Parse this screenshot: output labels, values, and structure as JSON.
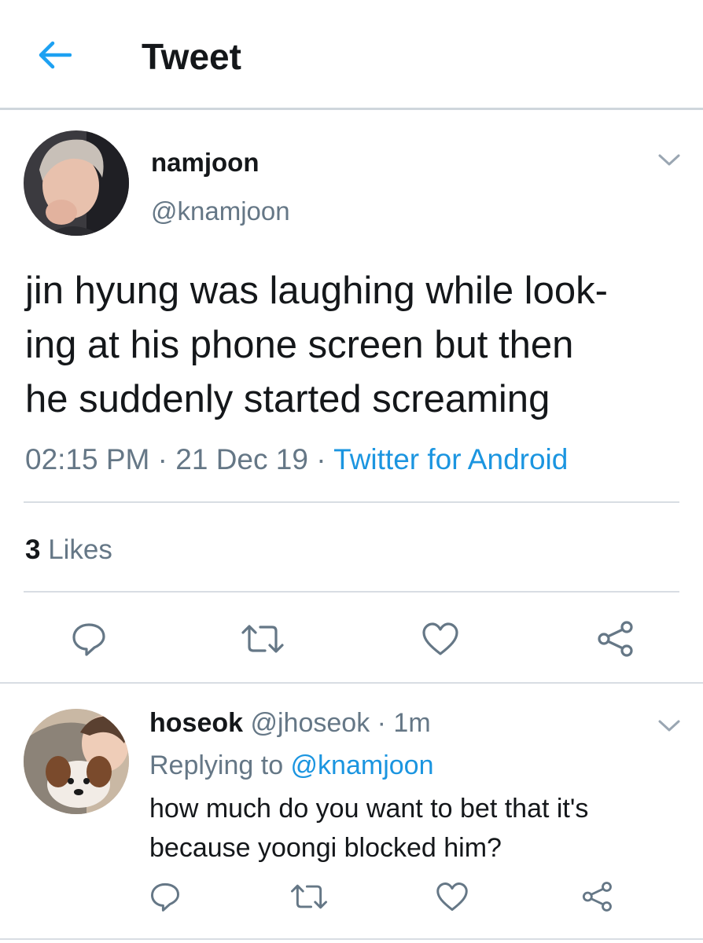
{
  "header": {
    "back_icon": "arrow-left-icon",
    "title": "Tweet",
    "accent_color": "#1da1f2"
  },
  "tweet": {
    "author_name": "namjoon",
    "author_handle": "@knamjoon",
    "avatar": "avatar-photo",
    "menu_icon": "chevron-down-icon",
    "text_line1": "jin hyung was laughing while look-",
    "text_line2": "ing at his phone screen but then",
    "text_line3": "he suddenly started screaming",
    "time": "02:15 PM",
    "sep1": " · ",
    "date": "21 Dec 19",
    "sep2": " · ",
    "source": "Twitter for Android",
    "likes_count": "3",
    "likes_label": " Likes",
    "actions": [
      "reply-icon",
      "retweet-icon",
      "like-icon",
      "share-icon"
    ]
  },
  "reply": {
    "author_name": "hoseok",
    "author_handle": " @jhoseok",
    "dot": " · ",
    "time": "1m",
    "replying_prefix": "Replying to ",
    "replying_to": "@knamjoon",
    "text_line1": "how much do you want to bet that it's",
    "text_line2": "because yoongi blocked him?",
    "menu_icon": "chevron-down-icon",
    "actions": [
      "reply-icon",
      "retweet-icon",
      "like-icon",
      "share-icon"
    ]
  },
  "colors": {
    "text_primary": "#14171a",
    "text_secondary": "#657786",
    "link": "#1b95e0",
    "divider": "#d8dde3"
  }
}
